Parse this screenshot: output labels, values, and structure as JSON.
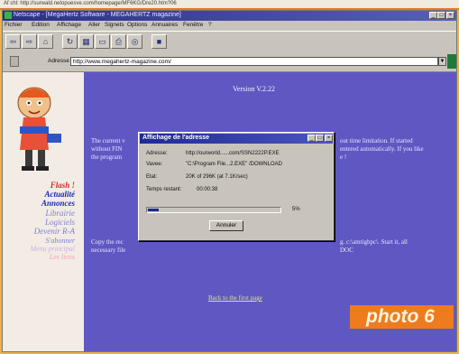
{
  "previous_window": {
    "address_text": "Af chl: http://surwald.netopuesve.com/homepage/MF6KG/Dre20.htm?06"
  },
  "window": {
    "title": "Netscape - [MegaHertz Software - MEGAHERTZ magazine]"
  },
  "menu": [
    "Fichier",
    "Edition",
    "Affichage",
    "Aller",
    "Signets",
    "Options",
    "Annuaires",
    "Fenêtre",
    "?"
  ],
  "toolbar": {
    "icons": [
      "back-icon",
      "forward-icon",
      "home-icon",
      "reload-icon",
      "images-icon",
      "open-icon",
      "print-icon",
      "find-icon",
      "stop-icon"
    ]
  },
  "address": {
    "label": "Adresse",
    "url": "http://www.megahertz-magazine.com/"
  },
  "sidebar": {
    "links": [
      {
        "label": "Flash !",
        "color": "#d9262b"
      },
      {
        "label": "Actualité",
        "color": "#1b2bb0"
      },
      {
        "label": "Annonces",
        "color": "#1b2bb0"
      },
      {
        "label": "Librairie",
        "color": "#7a7fd8"
      },
      {
        "label": "Logiciels",
        "color": "#7a7fd8"
      },
      {
        "label": "Devenir R-A",
        "color": "#7a7fd8"
      },
      {
        "label": "S'abonner",
        "color": "#7a7fd8"
      },
      {
        "label": "Menu principal",
        "color": "#c9b2e8"
      },
      {
        "label": "Les liens",
        "color": "#f2a3b8"
      }
    ]
  },
  "main": {
    "version": "Version V.2.22",
    "paragraph1": [
      "The current v",
      "without FIN",
      "the program"
    ],
    "paragraph1_right": [
      "out time limitation. If started",
      "entered automatically. If you like",
      "e !"
    ],
    "paragraph2": [
      "Copy the rec",
      "necessary file"
    ],
    "paragraph2_right": [
      "g. c:\\amtighpc\\. Start it, all",
      "DOC"
    ],
    "back_link": "Back to the first page"
  },
  "dialog": {
    "title": "Affichage de l'adresse",
    "rows": [
      {
        "label": "Adresse:",
        "value": "http://ourworld......com/SSN2222P.EXE"
      },
      {
        "label": "Vavee:",
        "value": "\"C:\\Program File...2.EXE\" /DOWNLOAD"
      },
      {
        "label": "Etat:",
        "value": "20K of 296K (at 7.1K/sec)"
      },
      {
        "label": "Temps restant:",
        "value": "00:00:38"
      }
    ],
    "progress": 0.08,
    "progress_label": "5%",
    "cancel_label": "Annuler"
  },
  "badge": {
    "text": "photo 6"
  },
  "colors": {
    "page_background": "#5f58c3",
    "title_bar": "#2a2f8a",
    "badge": "#ee7c1f"
  }
}
